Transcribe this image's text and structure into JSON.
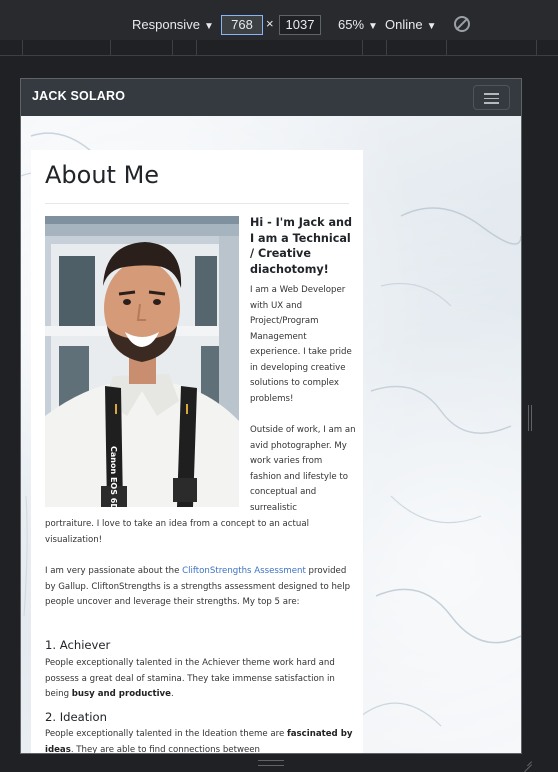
{
  "devtools": {
    "device": "Responsive",
    "width": "768",
    "separator": "×",
    "height": "1037",
    "zoom": "65%",
    "network": "Online"
  },
  "site": {
    "brand": "JACK SOLARO",
    "title": "About Me",
    "greeting": "Hi - I'm Jack and I am a Technical / Creative diachotomy!",
    "intro": "I am a Web Developer with UX and Project/Program Management experience. I take pride in developing creative solutions to complex problems!",
    "outside_side": "Outside of work, I am an avid photographer. My work varies from fashion and lifestyle to conceptual and surrealistic",
    "outside_full": "portraiture. I love to take an idea from a concept to an actual visualization!",
    "cs_before": "I am very passionate about the ",
    "cs_link": "CliftonStrengths Assessment",
    "cs_after": " provided by Gallup. CliftonStrengths is a strengths assessment designed to help people uncover and leverage their strengths. My top 5 are:",
    "strength1_title": "1. Achiever",
    "strength1_text_a": "People exceptionally talented in the Achiever theme work hard and possess a great deal of stamina. They take immense satisfaction in being ",
    "strength1_bold": "busy and productive",
    "strength1_text_b": ".",
    "strength2_title": "2. Ideation",
    "strength2_text_a": "People exceptionally talented in the Ideation theme are ",
    "strength2_bold": "fascinated by ideas",
    "strength2_text_b": ". They are able to find connections between",
    "strap_text": "Canon EOS 6D"
  }
}
